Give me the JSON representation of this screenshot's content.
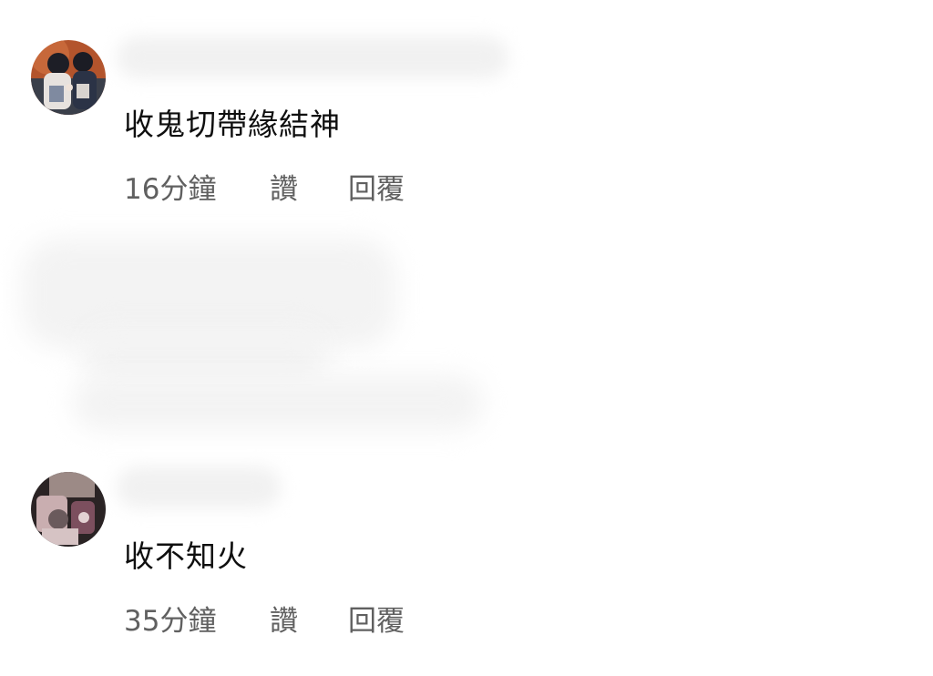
{
  "comments": [
    {
      "text": "收鬼切帶緣結神",
      "time": "16分鐘",
      "like_label": "讚",
      "reply_label": "回覆"
    },
    {
      "text": "收不知火",
      "time": "35分鐘",
      "like_label": "讚",
      "reply_label": "回覆"
    }
  ]
}
